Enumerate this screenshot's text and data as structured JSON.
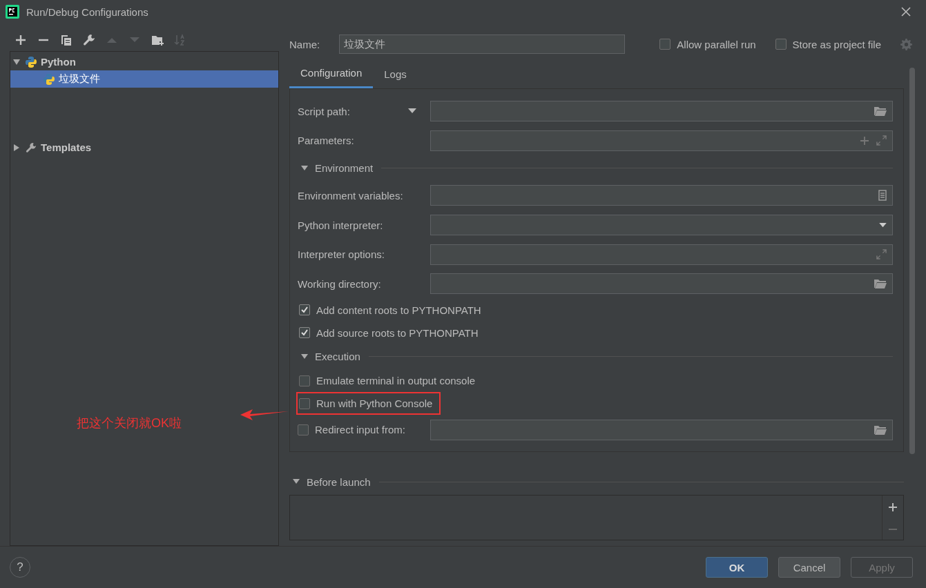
{
  "window": {
    "title": "Run/Debug Configurations"
  },
  "toolbar": [
    {
      "disabled": false
    },
    {
      "disabled": false
    },
    {
      "disabled": false
    },
    {
      "disabled": false
    },
    {
      "disabled": true
    },
    {
      "disabled": true
    },
    {
      "disabled": false
    },
    {
      "disabled": true
    }
  ],
  "tree": [
    {
      "label": "Python",
      "expanded": true,
      "children": [
        {
          "label": "垃圾文件",
          "selected": true
        }
      ]
    },
    {
      "label": "Templates",
      "expanded": false
    }
  ],
  "name_field": {
    "label": "Name:",
    "value": "垃圾文件"
  },
  "options": [
    {
      "label": "Allow parallel run",
      "checked": false
    },
    {
      "label": "Store as project file",
      "checked": false
    }
  ],
  "tabs": [
    {
      "label": "Configuration",
      "selected": true
    },
    {
      "label": "Logs",
      "selected": false
    }
  ],
  "form": [
    {
      "kind": "path-field",
      "label": "Script path:",
      "dropdown": true
    },
    {
      "kind": "params-field",
      "label": "Parameters:",
      "dropdown": false
    },
    {
      "kind": "section",
      "label": "Environment"
    },
    {
      "kind": "env-field",
      "label": "Environment variables:",
      "dropdown": false
    },
    {
      "kind": "select-field",
      "label": "Python interpreter:",
      "dropdown": false
    },
    {
      "kind": "options-field",
      "label": "Interpreter options:",
      "dropdown": false
    },
    {
      "kind": "path-field",
      "label": "Working directory:",
      "dropdown": false
    },
    {
      "kind": "checkbox",
      "label": "Add content roots to PYTHONPATH",
      "checked": true,
      "highlighted": false
    },
    {
      "kind": "checkbox",
      "label": "Add source roots to PYTHONPATH",
      "checked": true,
      "highlighted": false
    },
    {
      "kind": "section",
      "label": "Execution"
    },
    {
      "kind": "checkbox",
      "label": "Emulate terminal in output console",
      "checked": false,
      "highlighted": false
    },
    {
      "kind": "checkbox",
      "label": "Run with Python Console",
      "checked": false,
      "highlighted": true
    },
    {
      "kind": "checkbox-field",
      "label": "Redirect input from:",
      "checked": false
    }
  ],
  "before_launch": {
    "label": "Before launch",
    "expanded": true
  },
  "annotation": {
    "text": "把这个关闭就OK啦"
  },
  "help_button": {
    "label": "?"
  },
  "buttons": [
    {
      "label": "OK",
      "default": true,
      "disabled": false
    },
    {
      "label": "Cancel",
      "default": false,
      "disabled": false
    },
    {
      "label": "Apply",
      "default": false,
      "disabled": true
    }
  ]
}
